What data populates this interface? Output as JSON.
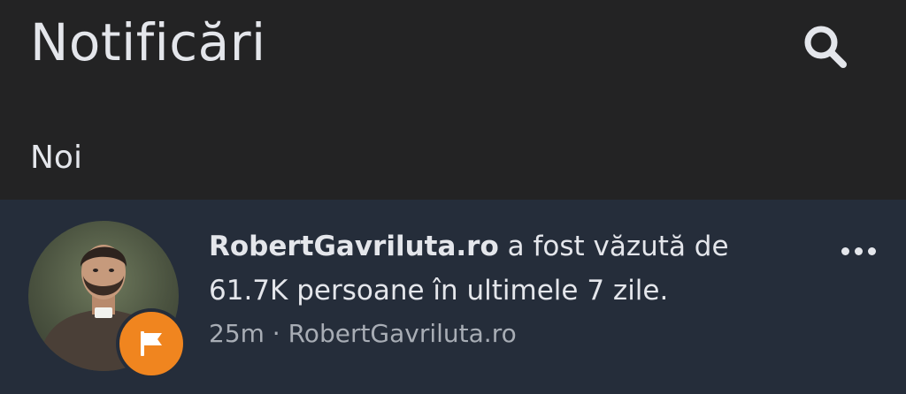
{
  "header": {
    "title": "Notificări",
    "search_icon": "search-icon"
  },
  "section": {
    "title": "Noi"
  },
  "notification": {
    "page_name": "RobertGavriluta.ro",
    "message_rest_line1": " a fost văzută de",
    "message_line2": "61.7K persoane în ultimele 7 zile.",
    "time": "25m",
    "separator": " · ",
    "source": "RobertGavriluta.ro",
    "badge_icon": "flag-icon",
    "badge_color": "#f0851f",
    "more_icon": "more-horizontal-icon",
    "unread_background": "#252d3a"
  }
}
